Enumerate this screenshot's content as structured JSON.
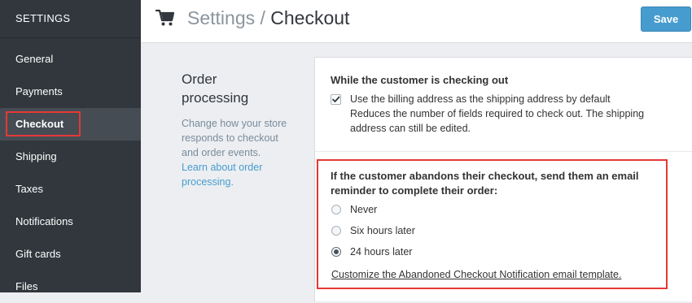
{
  "sidebar": {
    "heading": "SETTINGS",
    "items": [
      {
        "label": "General"
      },
      {
        "label": "Payments"
      },
      {
        "label": "Checkout"
      },
      {
        "label": "Shipping"
      },
      {
        "label": "Taxes"
      },
      {
        "label": "Notifications"
      },
      {
        "label": "Gift cards"
      },
      {
        "label": "Files"
      }
    ],
    "active_item": "Checkout"
  },
  "header": {
    "icon": "shopping-cart-icon",
    "title_parent": "Settings",
    "title_separator": "/",
    "title_current": "Checkout",
    "save_label": "Save"
  },
  "section": {
    "title_line1": "Order",
    "title_line2": "processing",
    "description": "Change how your store responds to checkout and order events.",
    "link_text": "Learn about order processing."
  },
  "checkout_group": {
    "heading": "While the customer is checking out",
    "checkbox_label": "Use the billing address as the shipping address by default",
    "checkbox_checked": true,
    "hint_line1": "Reduces the number of fields required to check out. The shipping",
    "hint_line2": "address can still be edited."
  },
  "abandon_group": {
    "heading_line1": "If the customer abandons their checkout, send them an email",
    "heading_line2": "reminder to complete their order:",
    "options": [
      {
        "label": "Never",
        "checked": false
      },
      {
        "label": "Six hours later",
        "checked": false
      },
      {
        "label": "24 hours later",
        "checked": true
      }
    ],
    "template_link": "Customize the Abandoned Checkout Notification email template."
  },
  "colors": {
    "sidebar_bg": "#31373d",
    "sidebar_active_bg": "#454c53",
    "accent_blue": "#479ccf",
    "highlight_red": "#e53935",
    "page_bg": "#eceef1"
  }
}
